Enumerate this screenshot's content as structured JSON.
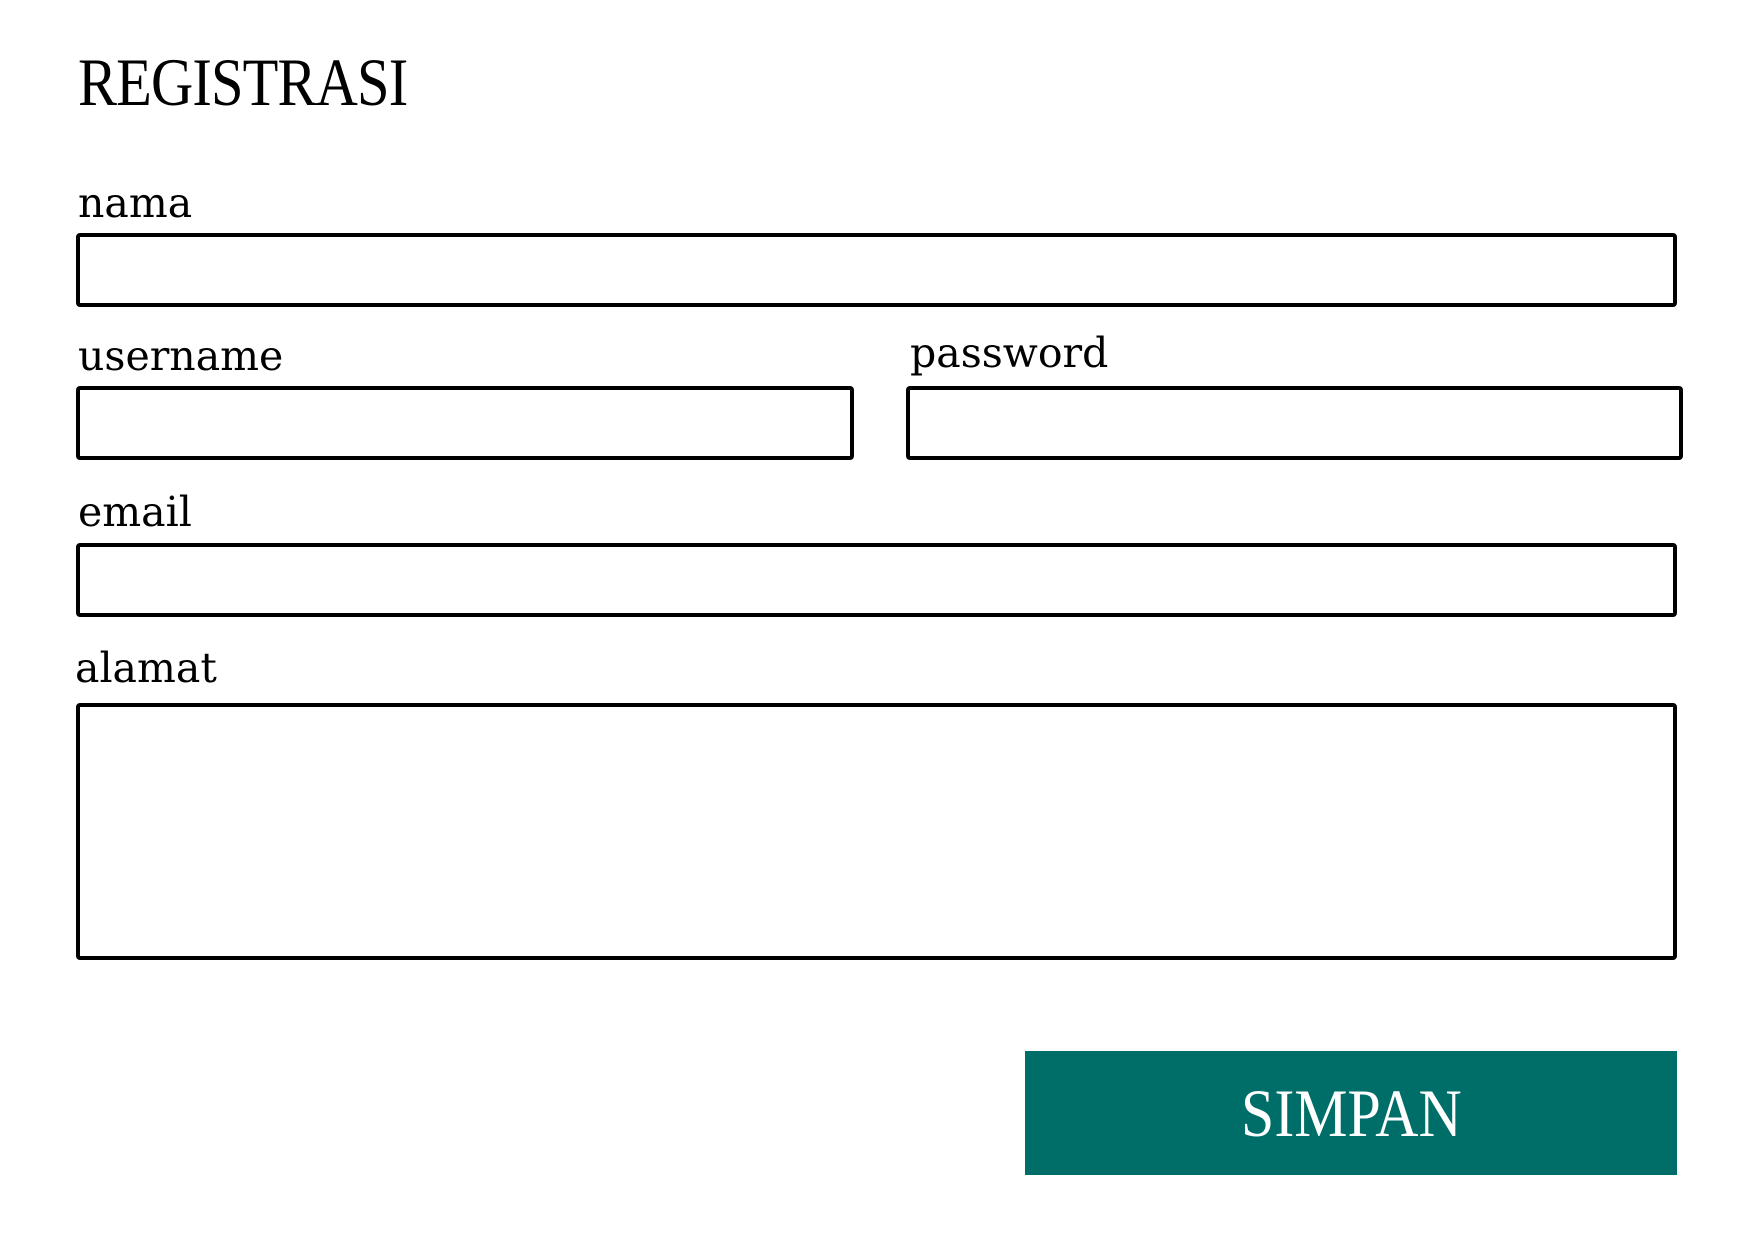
{
  "form": {
    "title": "REGISTRASI",
    "fields": {
      "nama": {
        "label": "nama",
        "value": "",
        "placeholder": ""
      },
      "username": {
        "label": "username",
        "value": "",
        "placeholder": ""
      },
      "password": {
        "label": "password",
        "value": "",
        "placeholder": ""
      },
      "email": {
        "label": "email",
        "value": "",
        "placeholder": ""
      },
      "alamat": {
        "label": "alamat",
        "value": "",
        "placeholder": ""
      }
    },
    "submit_label": "SIMPAN"
  },
  "colors": {
    "button_bg": "#006e68",
    "button_text": "#ffffff",
    "border": "#000000",
    "background": "#ffffff"
  }
}
